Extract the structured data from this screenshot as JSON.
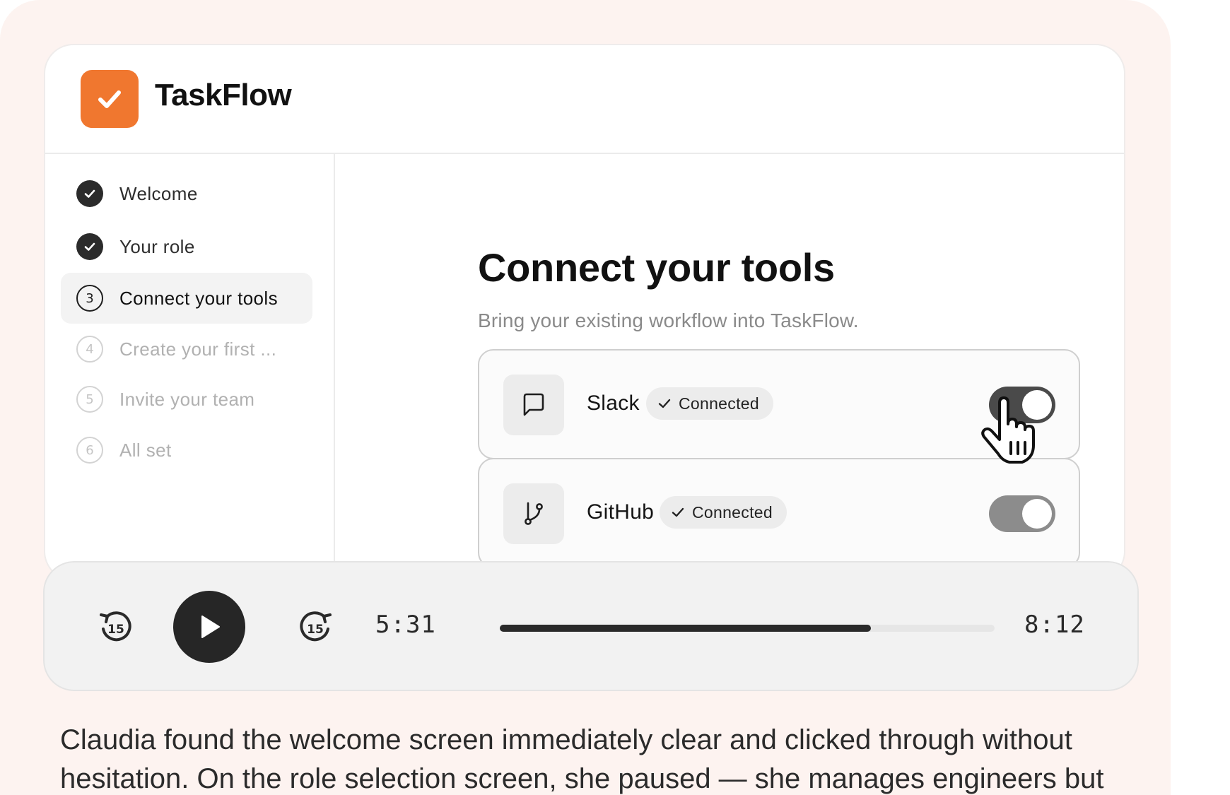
{
  "app": {
    "name": "TaskFlow",
    "logo_icon": "checkmark-icon",
    "brand_color": "#f0772f"
  },
  "steps": [
    {
      "index": "1",
      "label": "Welcome",
      "status": "done"
    },
    {
      "index": "2",
      "label": "Your role",
      "status": "done"
    },
    {
      "index": "3",
      "label": "Connect your tools",
      "status": "current"
    },
    {
      "index": "4",
      "label": "Create your first ...",
      "status": "pending"
    },
    {
      "index": "5",
      "label": "Invite your team",
      "status": "pending"
    },
    {
      "index": "6",
      "label": "All set",
      "status": "pending"
    }
  ],
  "main": {
    "title": "Connect your tools",
    "subtitle": "Bring your existing workflow into TaskFlow.",
    "tools": [
      {
        "name": "Slack",
        "icon": "message-square-icon",
        "status": "Connected",
        "toggle_on": true,
        "toggle_color": "#4a4a4a"
      },
      {
        "name": "GitHub",
        "icon": "git-branch-icon",
        "status": "Connected",
        "toggle_on": true,
        "toggle_color": "#8c8c8c"
      }
    ]
  },
  "player": {
    "current_time": "5:31",
    "total_time": "8:12",
    "progress": 0.75,
    "rewind_icon": "rewind-15-icon",
    "play_icon": "play-icon",
    "forward_icon": "forward-15-icon",
    "skip_seconds": "15"
  },
  "caption": "Claudia found the welcome screen immediately clear and clicked through without hesitation. On the role selection screen, she paused — she manages engineers but"
}
